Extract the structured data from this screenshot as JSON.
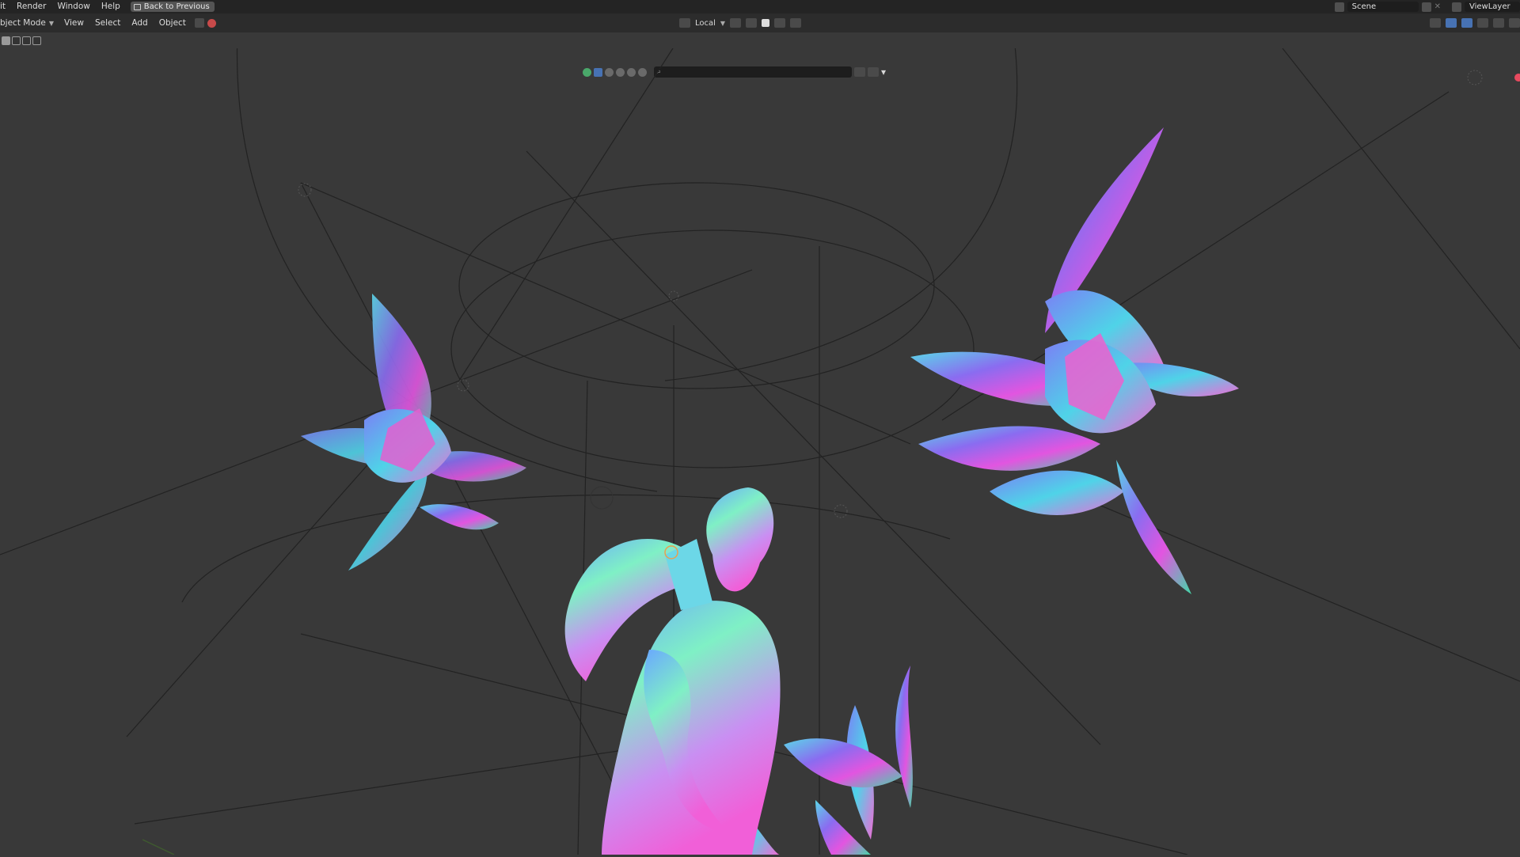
{
  "topbar": {
    "menu": [
      "it",
      "Render",
      "Window",
      "Help"
    ],
    "back_label": "Back to Previous",
    "scene_label": "Scene",
    "view_layer_label": "ViewLayer"
  },
  "header": {
    "mode_label": "bject Mode",
    "menu": [
      "View",
      "Select",
      "Add",
      "Object"
    ],
    "orientation_label": "Local"
  },
  "viewport": {
    "content": "3D viewport with a normal-shaded posed character figure and three iridescent feather/fur clusters over wireframe curves"
  },
  "colors": {
    "bg": "#393939",
    "topbar": "#242424",
    "header": "#2c2c2c",
    "accent": "#4772b3"
  }
}
